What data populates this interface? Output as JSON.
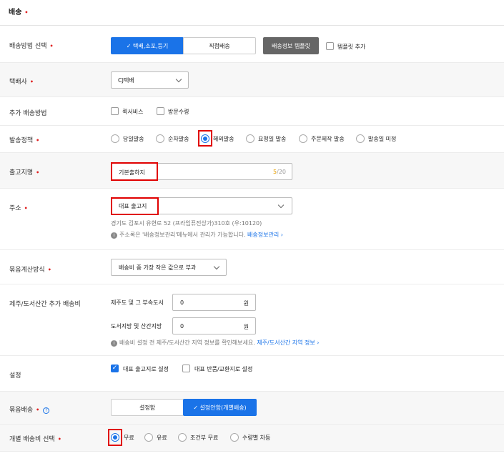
{
  "section": {
    "title": "배송",
    "required_mark": "•"
  },
  "shipping_method": {
    "label": "배송방법 선택",
    "options": [
      "✓ 택배,소포,등기",
      "직접배송"
    ],
    "template_button": "배송정보 템플릿",
    "template_add_label": "템플릿 추가"
  },
  "courier": {
    "label": "택배사",
    "value": "CJ택배"
  },
  "extra_method": {
    "label": "추가 배송방법",
    "options": [
      "퀵서비스",
      "방문수령"
    ]
  },
  "dispatch_policy": {
    "label": "발송정책",
    "options": [
      "당일발송",
      "순차발송",
      "해외발송",
      "요청일 발송",
      "주문제작 발송",
      "발송일 미정"
    ],
    "selected": "해외발송"
  },
  "origin_name": {
    "label": "출고지명",
    "value": "기본출하지",
    "counter_current": "5",
    "counter_max": "/20"
  },
  "address": {
    "label": "주소",
    "value": "대표 출고지",
    "detail": "경기도 김포시 유현로 52 (프라임퓨전상가)310호 (우:10120)",
    "help": "주소록은 '배송정보관리'메뉴에서 관리가 가능합니다.",
    "help_link": "배송정보관리 ›"
  },
  "bundle_calc": {
    "label": "묶음계산방식",
    "value": "배송비 중 가장 작은 값으로 부과"
  },
  "jeju": {
    "label": "제주/도서산간 추가 배송비",
    "jeju_label": "제주도 및 그 부속도서",
    "jeju_value": "0",
    "island_label": "도서지방 및 산간지방",
    "island_value": "0",
    "unit": "원",
    "help": "배송비 설정 전 제주/도서산간 지역 정보를 확인해보세요.",
    "help_link": "제주/도서산간 지역 정보 ›"
  },
  "settings": {
    "label": "설정",
    "options": [
      "대표 출고지로 설정",
      "대표 반품/교환지로 설정"
    ]
  },
  "bundle_ship": {
    "label": "묶음배송",
    "options": [
      "설정함",
      "✓ 설정안함(개별배송)"
    ]
  },
  "individual_fee": {
    "label": "개별 배송비 선택",
    "options": [
      "무료",
      "유료",
      "조건부 무료",
      "수량별 차등"
    ],
    "selected": "무료"
  },
  "colors": {
    "accent": "#1a73e8",
    "required": "#e02020",
    "highlight": "#e00000"
  },
  "icons": [
    "check-icon",
    "chevron-down-icon",
    "info-icon",
    "help-circle-icon"
  ]
}
